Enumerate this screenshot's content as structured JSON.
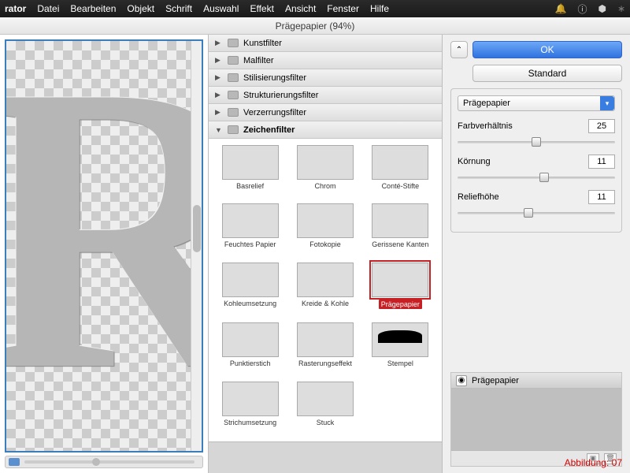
{
  "menubar": {
    "app": "rator",
    "items": [
      "Datei",
      "Bearbeiten",
      "Objekt",
      "Schrift",
      "Auswahl",
      "Effekt",
      "Ansicht",
      "Fenster",
      "Hilfe"
    ]
  },
  "window": {
    "title": "Prägepapier (94%)"
  },
  "preview": {
    "glyph": "R"
  },
  "categories": [
    {
      "label": "Kunstfilter",
      "expanded": false
    },
    {
      "label": "Malfilter",
      "expanded": false
    },
    {
      "label": "Stilisierungsfilter",
      "expanded": false
    },
    {
      "label": "Strukturierungsfilter",
      "expanded": false
    },
    {
      "label": "Verzerrungsfilter",
      "expanded": false
    },
    {
      "label": "Zeichenfilter",
      "expanded": true
    }
  ],
  "thumbs": [
    {
      "label": "Basrelief",
      "cls": "sw-bas"
    },
    {
      "label": "Chrom",
      "cls": "sw-chrom"
    },
    {
      "label": "Conté-Stifte",
      "cls": "sw-conte"
    },
    {
      "label": "Feuchtes Papier",
      "cls": "sw-feu"
    },
    {
      "label": "Fotokopie",
      "cls": "sw-foto"
    },
    {
      "label": "Gerissene Kanten",
      "cls": "sw-ger"
    },
    {
      "label": "Kohleumsetzung",
      "cls": "sw-kohl"
    },
    {
      "label": "Kreide & Kohle",
      "cls": "sw-kreid"
    },
    {
      "label": "Prägepapier",
      "cls": "sw-noteP",
      "selected": true
    },
    {
      "label": "Punktierstich",
      "cls": "sw-punkt"
    },
    {
      "label": "Rasterungseffekt",
      "cls": "sw-rast"
    },
    {
      "label": "Stempel",
      "cls": "sw-stemp"
    },
    {
      "label": "Strichumsetzung",
      "cls": "sw-stri"
    },
    {
      "label": "Stuck",
      "cls": "sw-stuck"
    }
  ],
  "settings": {
    "ok": "OK",
    "standard": "Standard",
    "filter_select": "Prägepapier",
    "sliders": [
      {
        "label": "Farbverhältnis",
        "value": "25",
        "pos": 50
      },
      {
        "label": "Körnung",
        "value": "11",
        "pos": 55
      },
      {
        "label": "Reliefhöhe",
        "value": "11",
        "pos": 45
      }
    ]
  },
  "layers": {
    "title": "Prägepapier"
  },
  "caption": "Abbildung: 07"
}
